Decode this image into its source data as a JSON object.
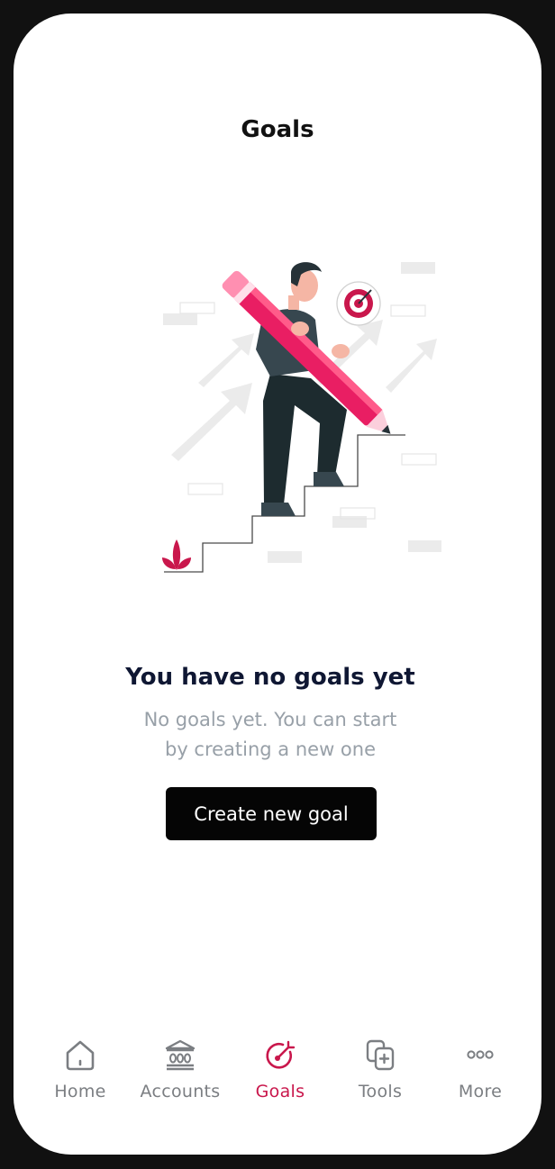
{
  "header": {
    "title": "Goals"
  },
  "empty_state": {
    "illustration": "person-carrying-pencil-up-stairs-illustration",
    "title": "You have no goals yet",
    "description": "No goals yet. You can start by creating a new one",
    "button_label": "Create new goal"
  },
  "tabbar": {
    "items": [
      {
        "label": "Home",
        "icon": "home-icon",
        "active": false
      },
      {
        "label": "Accounts",
        "icon": "bank-icon",
        "active": false
      },
      {
        "label": "Goals",
        "icon": "target-icon",
        "active": true
      },
      {
        "label": "Tools",
        "icon": "tools-icon",
        "active": false
      },
      {
        "label": "More",
        "icon": "more-dots-icon",
        "active": false
      }
    ]
  },
  "colors": {
    "accent": "#c9174c",
    "button_bg": "#050505",
    "title_text": "#0f1733",
    "muted_text": "#98a0a8",
    "tab_inactive": "#7b7e82"
  }
}
